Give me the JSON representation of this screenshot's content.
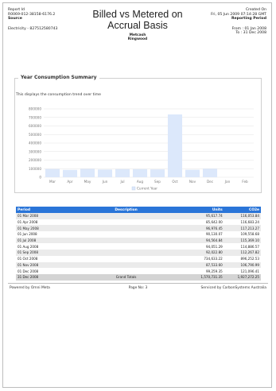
{
  "header": {
    "report_id_label": "Report Id",
    "report_id": "R0069-012-38158-6176.2",
    "source_label": "Source",
    "source": "Electricity - 827512580743",
    "title_line1": "Billed vs Metered on",
    "title_line2": "Accrual Basis",
    "sub1": "Metcash",
    "sub2": "Ringwood",
    "created_label": "Created On",
    "created_on": "Fri, 05 Jun 2009 07:14:28 GMT",
    "period_label": "Reporting Period",
    "from": "From : 01 Jan 2008",
    "to": "To : 31 Dec 2008"
  },
  "summary": {
    "title": "Year Consumption Summary",
    "description": "This displays the consumption trend over time"
  },
  "chart_data": {
    "type": "bar",
    "categories": [
      "Mar",
      "Apr",
      "May",
      "Jun",
      "Jul",
      "Aug",
      "Sep",
      "Oct",
      "Nov",
      "Dec",
      "Jan",
      "Feb"
    ],
    "series": [
      {
        "name": "Current Year",
        "values": [
          95617.74,
          85642.0,
          96976.45,
          90130.07,
          94564.84,
          94051.29,
          92022.8,
          734633.22,
          87533.6,
          99259.35,
          0,
          0
        ]
      }
    ],
    "yticks": [
      "800000",
      "700000",
      "600000",
      "500000",
      "400000",
      "300000",
      "200000",
      "100000",
      "0"
    ],
    "ylim": [
      0,
      800000
    ],
    "grid": true,
    "legend": "bottom-center",
    "bar_color": "#dce8fb"
  },
  "table": {
    "columns": [
      "Period",
      "Description",
      "Units",
      "CO2e"
    ],
    "rows": [
      [
        "01 Mar 2008",
        "",
        "95,617.74",
        "116,053.84"
      ],
      [
        "01 Apr 2008",
        "",
        "85,642.00",
        "116,683.24"
      ],
      [
        "01 May 2008",
        "",
        "96,976.45",
        "117,213.27"
      ],
      [
        "01 Jun 2008",
        "",
        "90,130.07",
        "109,558.68"
      ],
      [
        "01 Jul 2008",
        "",
        "94,564.84",
        "115,369.10"
      ],
      [
        "01 Aug 2008",
        "",
        "94,051.29",
        "114,886.57"
      ],
      [
        "01 Sep 2008",
        "",
        "92,022.80",
        "112,267.82"
      ],
      [
        "01 Oct 2008",
        "",
        "734,633.22",
        "896,252.53"
      ],
      [
        "01 Nov 2008",
        "",
        "87,533.60",
        "106,790.99"
      ],
      [
        "01 Dec 2008",
        "",
        "99,259.35",
        "121,096.41"
      ]
    ],
    "total": [
      "31 Dec 2008",
      "Grand Totals",
      "1,570,731.35",
      "1,927,272.25"
    ]
  },
  "footer": {
    "left": "Powered by Omni Meta",
    "center": "Page No: 3",
    "right": "Serviced by CarbonSystems Australia"
  }
}
